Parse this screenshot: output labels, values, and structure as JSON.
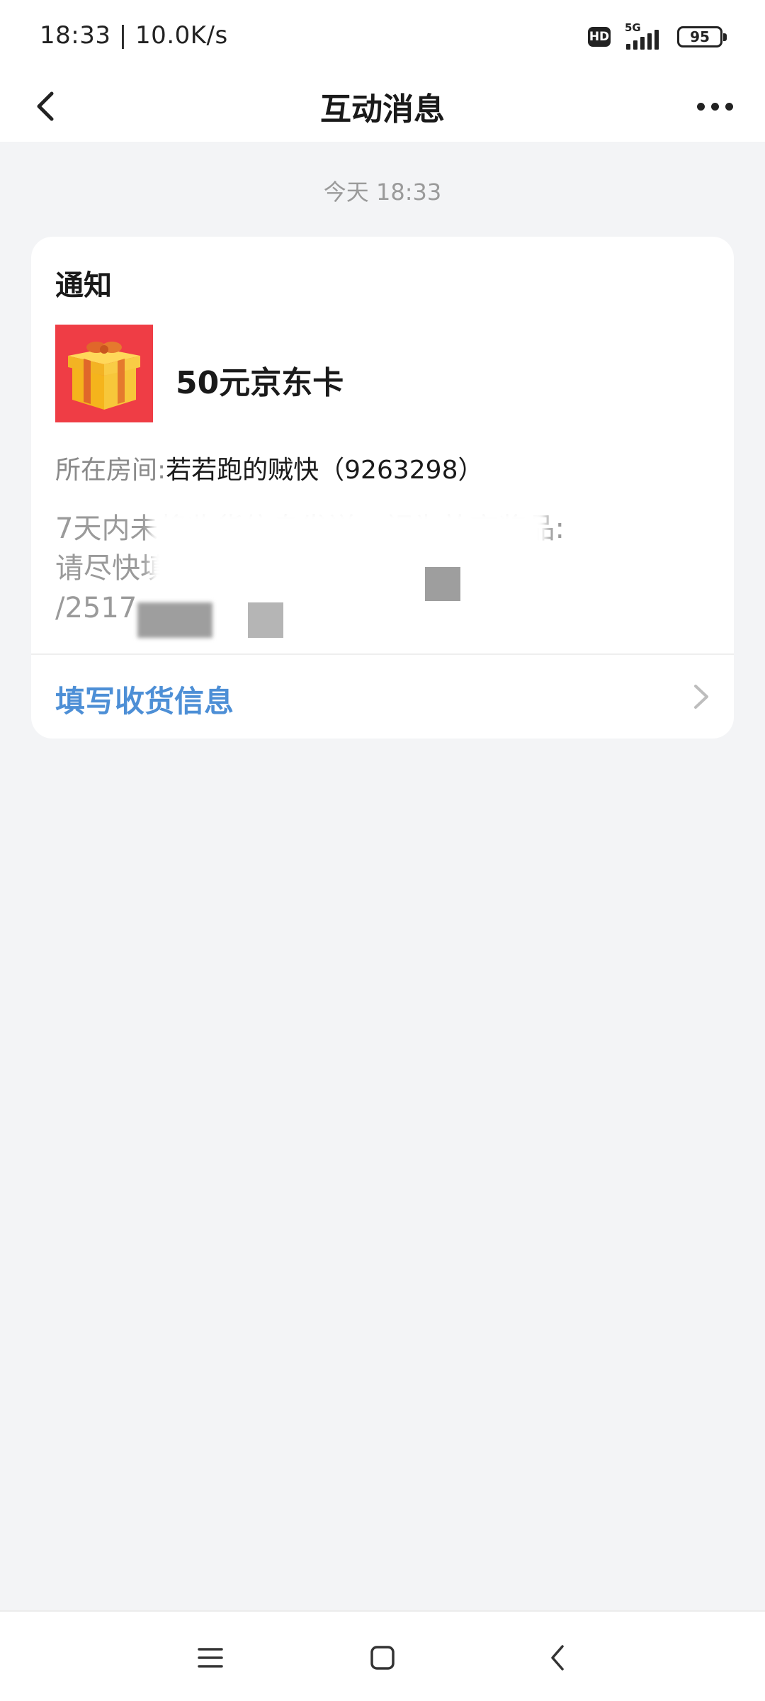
{
  "status_bar": {
    "time_speed": "18:33 | 10.0K/s",
    "hd_badge": "HD",
    "network": "5G",
    "battery": "95"
  },
  "nav": {
    "title": "互动消息"
  },
  "message": {
    "timestamp": "今天 18:33",
    "card": {
      "title": "通知",
      "prize_name": "50元京东卡",
      "room_label": "所在房间:",
      "room_value": "若若跑的贼快（9263298）",
      "desc_line1": "7天内未将收货信息发送，视为放弃奖品:",
      "desc_line2": "请尽快填写收货信息 qq.com/s2",
      "desc_line3": "/2517",
      "action_label": "填写收货信息"
    }
  },
  "colors": {
    "link": "#4d8fd6",
    "gift_background": "#ef3d45",
    "page_background": "#f3f4f6"
  },
  "icons": {
    "back": "chevron-left-icon",
    "more": "more-dots-icon",
    "action_arrow": "chevron-right-icon",
    "gift": "gift-box-icon",
    "nav_menu": "menu-icon",
    "nav_home": "home-square-icon",
    "nav_back": "back-triangle-icon"
  }
}
